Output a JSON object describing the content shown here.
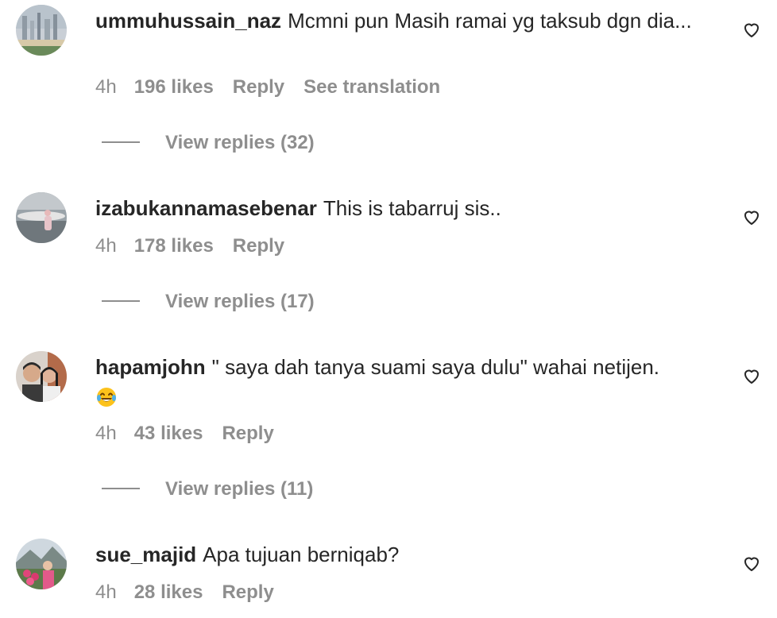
{
  "comments": [
    {
      "username": "ummuhussain_naz",
      "text": "Mcmni pun Masih ramai yg taksub dgn dia...",
      "time": "4h",
      "likes": "196 likes",
      "reply": "Reply",
      "translate": "See translation",
      "view_replies": "View replies (32)",
      "avatar_icon": "city-skyline-avatar"
    },
    {
      "username": "izabukannamasebenar",
      "text": "This is tabarruj sis..",
      "time": "4h",
      "likes": "178 likes",
      "reply": "Reply",
      "view_replies": "View replies (17)",
      "avatar_icon": "person-outdoor-avatar"
    },
    {
      "username": "hapamjohn",
      "text": "\" saya dah tanya suami saya dulu\" wahai netijen.",
      "emoji": "face-with-tears-of-joy",
      "time": "4h",
      "likes": "43 likes",
      "reply": "Reply",
      "view_replies": "View replies (11)",
      "avatar_icon": "couple-selfie-avatar"
    },
    {
      "username": "sue_majid",
      "text": "Apa tujuan berniqab?",
      "time": "4h",
      "likes": "28 likes",
      "reply": "Reply",
      "avatar_icon": "flowers-mountain-avatar"
    }
  ],
  "colors": {
    "text": "#262626",
    "secondary": "#8e8e8e",
    "background": "#ffffff"
  },
  "icons": {
    "like": "heart-outline-icon"
  }
}
